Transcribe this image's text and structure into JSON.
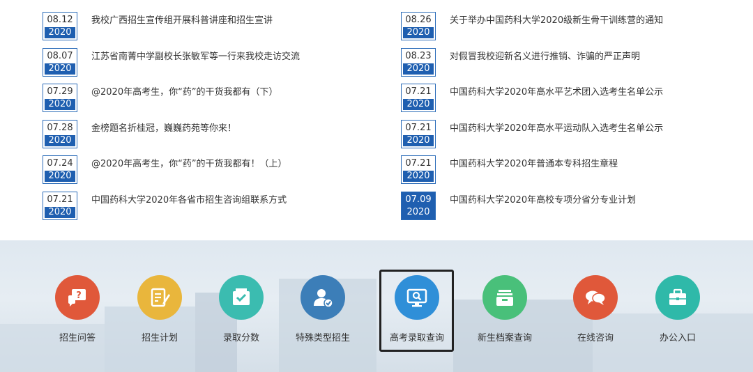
{
  "news": {
    "left": [
      {
        "md": "08.12",
        "year": "2020",
        "title": "我校广西招生宣传组开展科普讲座和招生宣讲"
      },
      {
        "md": "08.07",
        "year": "2020",
        "title": "江苏省南菁中学副校长张敏军等一行来我校走访交流"
      },
      {
        "md": "07.29",
        "year": "2020",
        "title": "@2020年高考生，你“药”的干货我都有（下）"
      },
      {
        "md": "07.28",
        "year": "2020",
        "title": "金榜题名折桂冠，巍巍药苑等你来！"
      },
      {
        "md": "07.24",
        "year": "2020",
        "title": "@2020年高考生，你“药”的干货我都有！（上）"
      },
      {
        "md": "07.21",
        "year": "2020",
        "title": "中国药科大学2020年各省市招生咨询组联系方式"
      }
    ],
    "right": [
      {
        "md": "08.26",
        "year": "2020",
        "title": "关于举办中国药科大学2020级新生骨干训练营的通知"
      },
      {
        "md": "08.23",
        "year": "2020",
        "title": "对假冒我校迎新名义进行推销、诈骗的严正声明"
      },
      {
        "md": "07.21",
        "year": "2020",
        "title": "中国药科大学2020年高水平艺术团入选考生名单公示"
      },
      {
        "md": "07.21",
        "year": "2020",
        "title": "中国药科大学2020年高水平运动队入选考生名单公示"
      },
      {
        "md": "07.21",
        "year": "2020",
        "title": "中国药科大学2020年普通本专科招生章程"
      },
      {
        "md": "07.09",
        "year": "2020",
        "title": "中国药科大学2020年高校专项分省分专业计划"
      }
    ]
  },
  "quicklinks": [
    {
      "label": "招生问答",
      "icon": "qa-icon",
      "color": "#e0583a"
    },
    {
      "label": "招生计划",
      "icon": "plan-icon",
      "color": "#e9b63c"
    },
    {
      "label": "录取分数",
      "icon": "score-icon",
      "color": "#3bbcb0"
    },
    {
      "label": "特殊类型招生",
      "icon": "special-icon",
      "color": "#3c7eb8"
    },
    {
      "label": "高考录取查询",
      "icon": "query-icon",
      "color": "#2f8fd8"
    },
    {
      "label": "新生档案查询",
      "icon": "archive-icon",
      "color": "#49c07a"
    },
    {
      "label": "在线咨询",
      "icon": "chat-icon",
      "color": "#e0583a"
    },
    {
      "label": "办公入口",
      "icon": "office-icon",
      "color": "#2fb9a9"
    }
  ]
}
